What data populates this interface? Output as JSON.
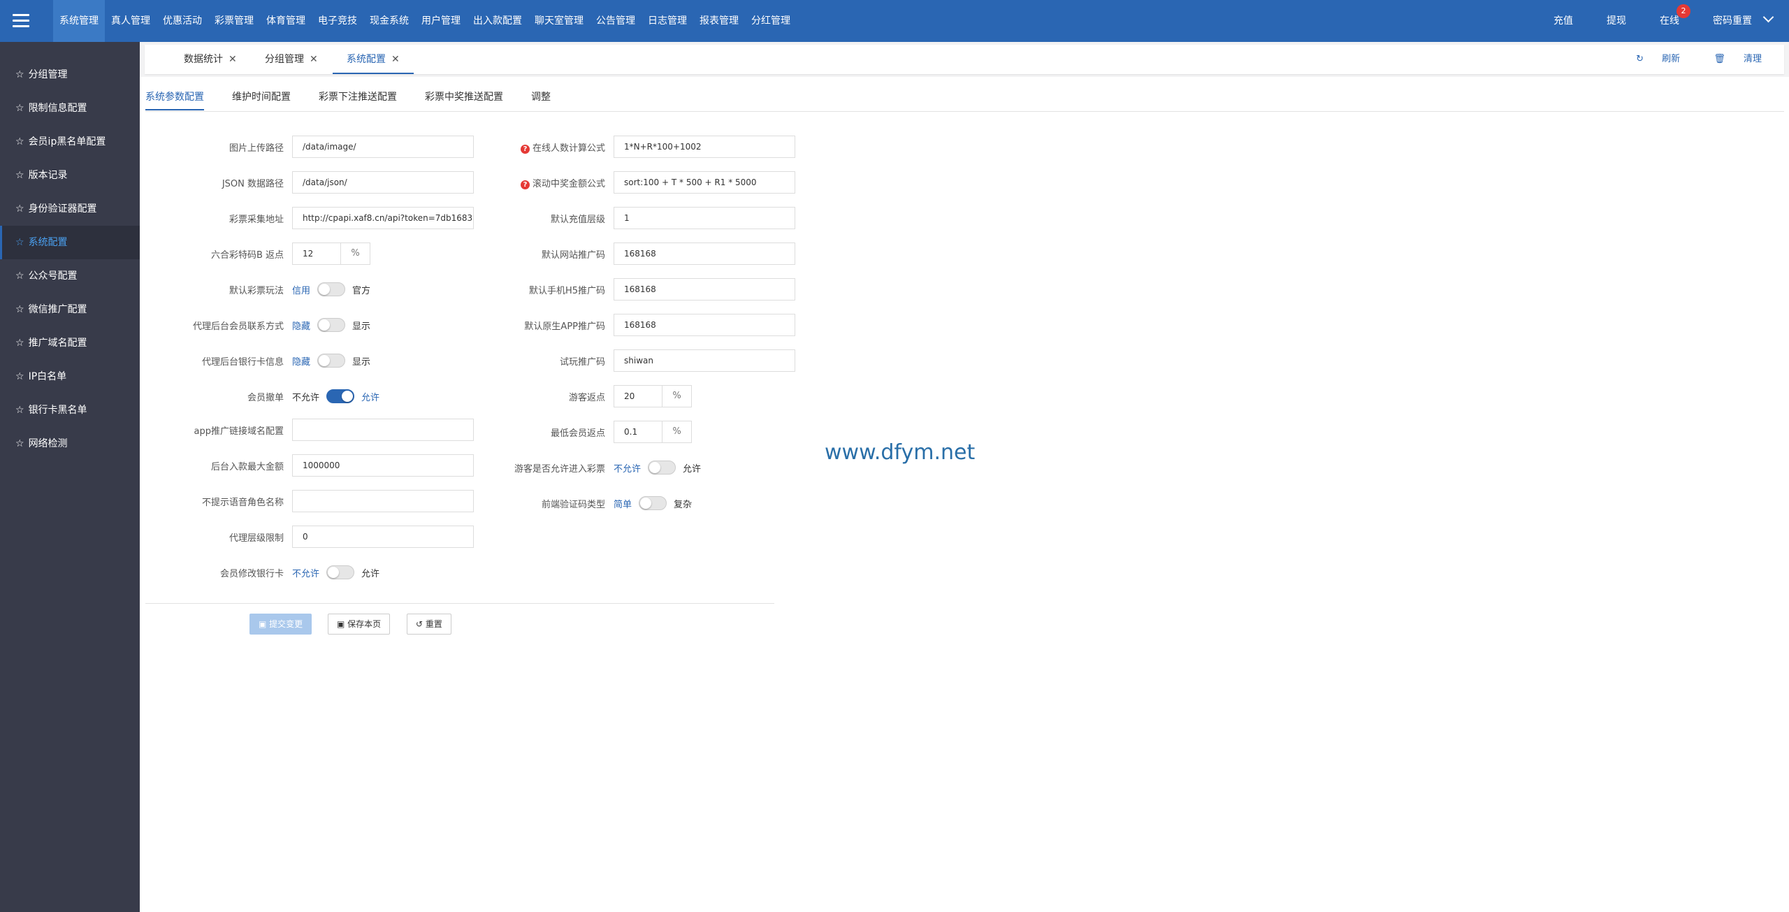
{
  "topnav": {
    "items": [
      "系统管理",
      "真人管理",
      "优惠活动",
      "彩票管理",
      "体育管理",
      "电子竞技",
      "现金系统",
      "用户管理",
      "出入款配置",
      "聊天室管理",
      "公告管理",
      "日志管理",
      "报表管理",
      "分红管理"
    ],
    "right": {
      "recharge": "充值",
      "withdraw": "提现",
      "online": "在线",
      "online_badge": "2",
      "reset_password": "密码重置"
    }
  },
  "sidebar": {
    "items": [
      "分组管理",
      "限制信息配置",
      "会员ip黑名单配置",
      "版本记录",
      "身份验证器配置",
      "系统配置",
      "公众号配置",
      "微信推广配置",
      "推广域名配置",
      "IP白名单",
      "银行卡黑名单",
      "网络检测"
    ],
    "active_index": 5
  },
  "tabs": {
    "items": [
      "数据统计",
      "分组管理",
      "系统配置"
    ],
    "refresh": "刷新",
    "clear": "清理"
  },
  "subtabs": [
    "系统参数配置",
    "维护时间配置",
    "彩票下注推送配置",
    "彩票中奖推送配置",
    "调整"
  ],
  "form": {
    "left": {
      "image_path": {
        "label": "图片上传路径",
        "value": "/data/image/"
      },
      "json_path": {
        "label": "JSON 数据路径",
        "value": "/data/json/"
      },
      "lottery_url": {
        "label": "彩票采集地址",
        "value": "http://cpapi.xaf8.cn/api?token=7db1683"
      },
      "liuhe_rebate": {
        "label": "六合彩特码B 返点",
        "value": "12",
        "suffix": "%"
      },
      "lottery_mode": {
        "label": "默认彩票玩法",
        "off": "信用",
        "on": "官方"
      },
      "agent_contact": {
        "label": "代理后台会员联系方式",
        "off": "隐藏",
        "on": "显示"
      },
      "agent_bankcard": {
        "label": "代理后台银行卡信息",
        "off": "隐藏",
        "on": "显示"
      },
      "member_cancel": {
        "label": "会员撤单",
        "off": "不允许",
        "on": "允许"
      },
      "app_domain": {
        "label": "app推广链接域名配置",
        "value": ""
      },
      "max_deposit": {
        "label": "后台入款最大金额",
        "value": "1000000"
      },
      "voice_role": {
        "label": "不提示语音角色名称",
        "value": ""
      },
      "agent_level": {
        "label": "代理层级限制",
        "value": "0"
      },
      "member_bankcard": {
        "label": "会员修改银行卡",
        "off": "不允许",
        "on": "允许"
      }
    },
    "right": {
      "online_formula": {
        "label": "在线人数计算公式",
        "value": "1*N+R*100+1002"
      },
      "scroll_formula": {
        "label": "滚动中奖金额公式",
        "value": "sort:100 + T * 500 + R1 * 5000"
      },
      "default_level": {
        "label": "默认充值层级",
        "value": "1"
      },
      "web_promo": {
        "label": "默认网站推广码",
        "value": "168168"
      },
      "h5_promo": {
        "label": "默认手机H5推广码",
        "value": "168168"
      },
      "app_promo": {
        "label": "默认原生APP推广码",
        "value": "168168"
      },
      "trial_promo": {
        "label": "试玩推广码",
        "value": "shiwan"
      },
      "guest_rebate": {
        "label": "游客返点",
        "value": "20",
        "suffix": "%"
      },
      "min_rebate": {
        "label": "最低会员返点",
        "value": "0.1",
        "suffix": "%"
      },
      "guest_lottery": {
        "label": "游客是否允许进入彩票",
        "off": "不允许",
        "on": "允许"
      },
      "captcha_type": {
        "label": "前端验证码类型",
        "off": "简单",
        "on": "复杂"
      }
    }
  },
  "buttons": {
    "submit": "提交变更",
    "save": "保存本页",
    "reset": "重置"
  },
  "watermark": "www.dfym.net"
}
